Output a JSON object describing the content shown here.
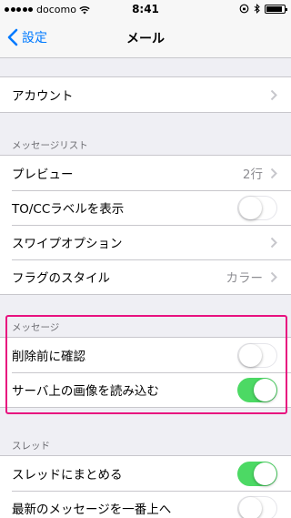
{
  "status_bar": {
    "carrier": "docomo",
    "time": "8:41",
    "battery_level": 0.9
  },
  "nav": {
    "back_label": "設定",
    "title": "メール"
  },
  "groups": {
    "account": {
      "rows": [
        {
          "label": "アカウント",
          "accessory": "chevron"
        }
      ]
    },
    "message_list": {
      "header": "メッセージリスト",
      "rows": [
        {
          "label": "プレビュー",
          "value": "2行",
          "accessory": "chevron"
        },
        {
          "label": "TO/CCラベルを表示",
          "accessory": "toggle",
          "on": false
        },
        {
          "label": "スワイプオプション",
          "accessory": "chevron"
        },
        {
          "label": "フラグのスタイル",
          "value": "カラー",
          "accessory": "chevron"
        }
      ]
    },
    "messages": {
      "header": "メッセージ",
      "rows": [
        {
          "label": "削除前に確認",
          "accessory": "toggle",
          "on": false
        },
        {
          "label": "サーバ上の画像を読み込む",
          "accessory": "toggle",
          "on": true
        }
      ]
    },
    "thread": {
      "header": "スレッド",
      "rows": [
        {
          "label": "スレッドにまとめる",
          "accessory": "toggle",
          "on": true
        },
        {
          "label": "最新のメッセージを一番上へ",
          "accessory": "toggle",
          "on": false
        }
      ]
    }
  },
  "colors": {
    "accent": "#007aff",
    "toggle_on": "#4cd964",
    "highlight": "#e8117f"
  }
}
